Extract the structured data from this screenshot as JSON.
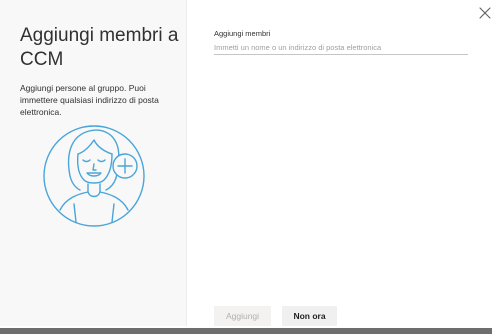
{
  "dialog": {
    "title": "Aggiungi membri a CCM",
    "description": "Aggiungi persone al gruppo. Puoi immettere qualsiasi indirizzo di posta elettronica.",
    "close_icon": "close-icon"
  },
  "form": {
    "members_label": "Aggiungi membri",
    "members_placeholder": "Immetti un nome o un indirizzo di posta elettronica",
    "members_value": ""
  },
  "footer": {
    "add_label": "Aggiungi",
    "not_now_label": "Non ora"
  },
  "colors": {
    "accent_illustration": "#4aa5d8",
    "left_pane_bg": "#f8f8f8"
  }
}
